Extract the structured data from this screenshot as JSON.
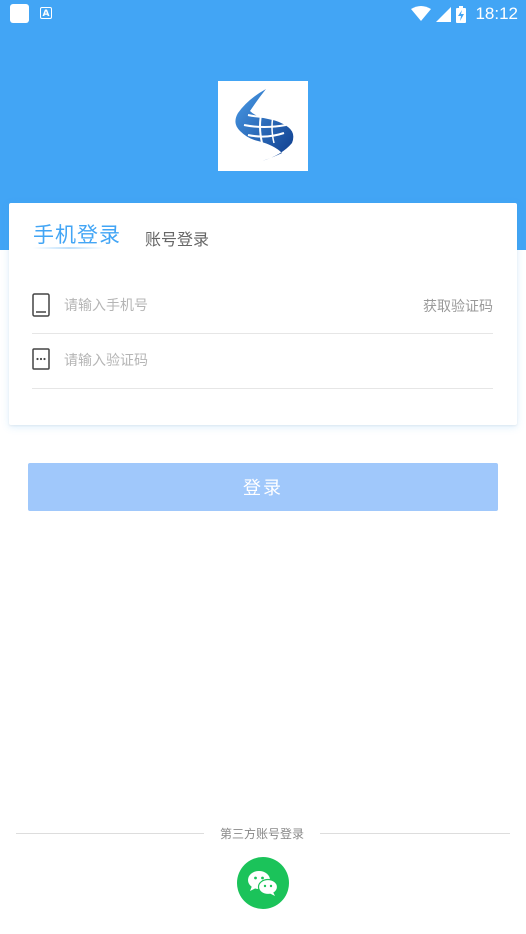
{
  "status_bar": {
    "time": "18:12",
    "icons": [
      "app-notification-icon",
      "a-letter-icon",
      "wifi-icon",
      "cellular-signal-icon",
      "battery-charging-icon"
    ]
  },
  "logo": {
    "icon": "company-logo"
  },
  "login_tabs": {
    "active": "手机登录",
    "inactive": "账号登录"
  },
  "phone_field": {
    "placeholder": "请输入手机号",
    "value": "",
    "icon": "phone-icon",
    "get_code_label": "获取验证码"
  },
  "code_field": {
    "placeholder": "请输入验证码",
    "value": "",
    "icon": "message-code-icon"
  },
  "login_button": {
    "label": "登录"
  },
  "third_party": {
    "label": "第三方账号登录",
    "wechat_icon": "wechat-icon"
  },
  "colors": {
    "primary": "#42a5f5",
    "button_disabled": "#a0c8fb",
    "wechat": "#1bc35a"
  }
}
